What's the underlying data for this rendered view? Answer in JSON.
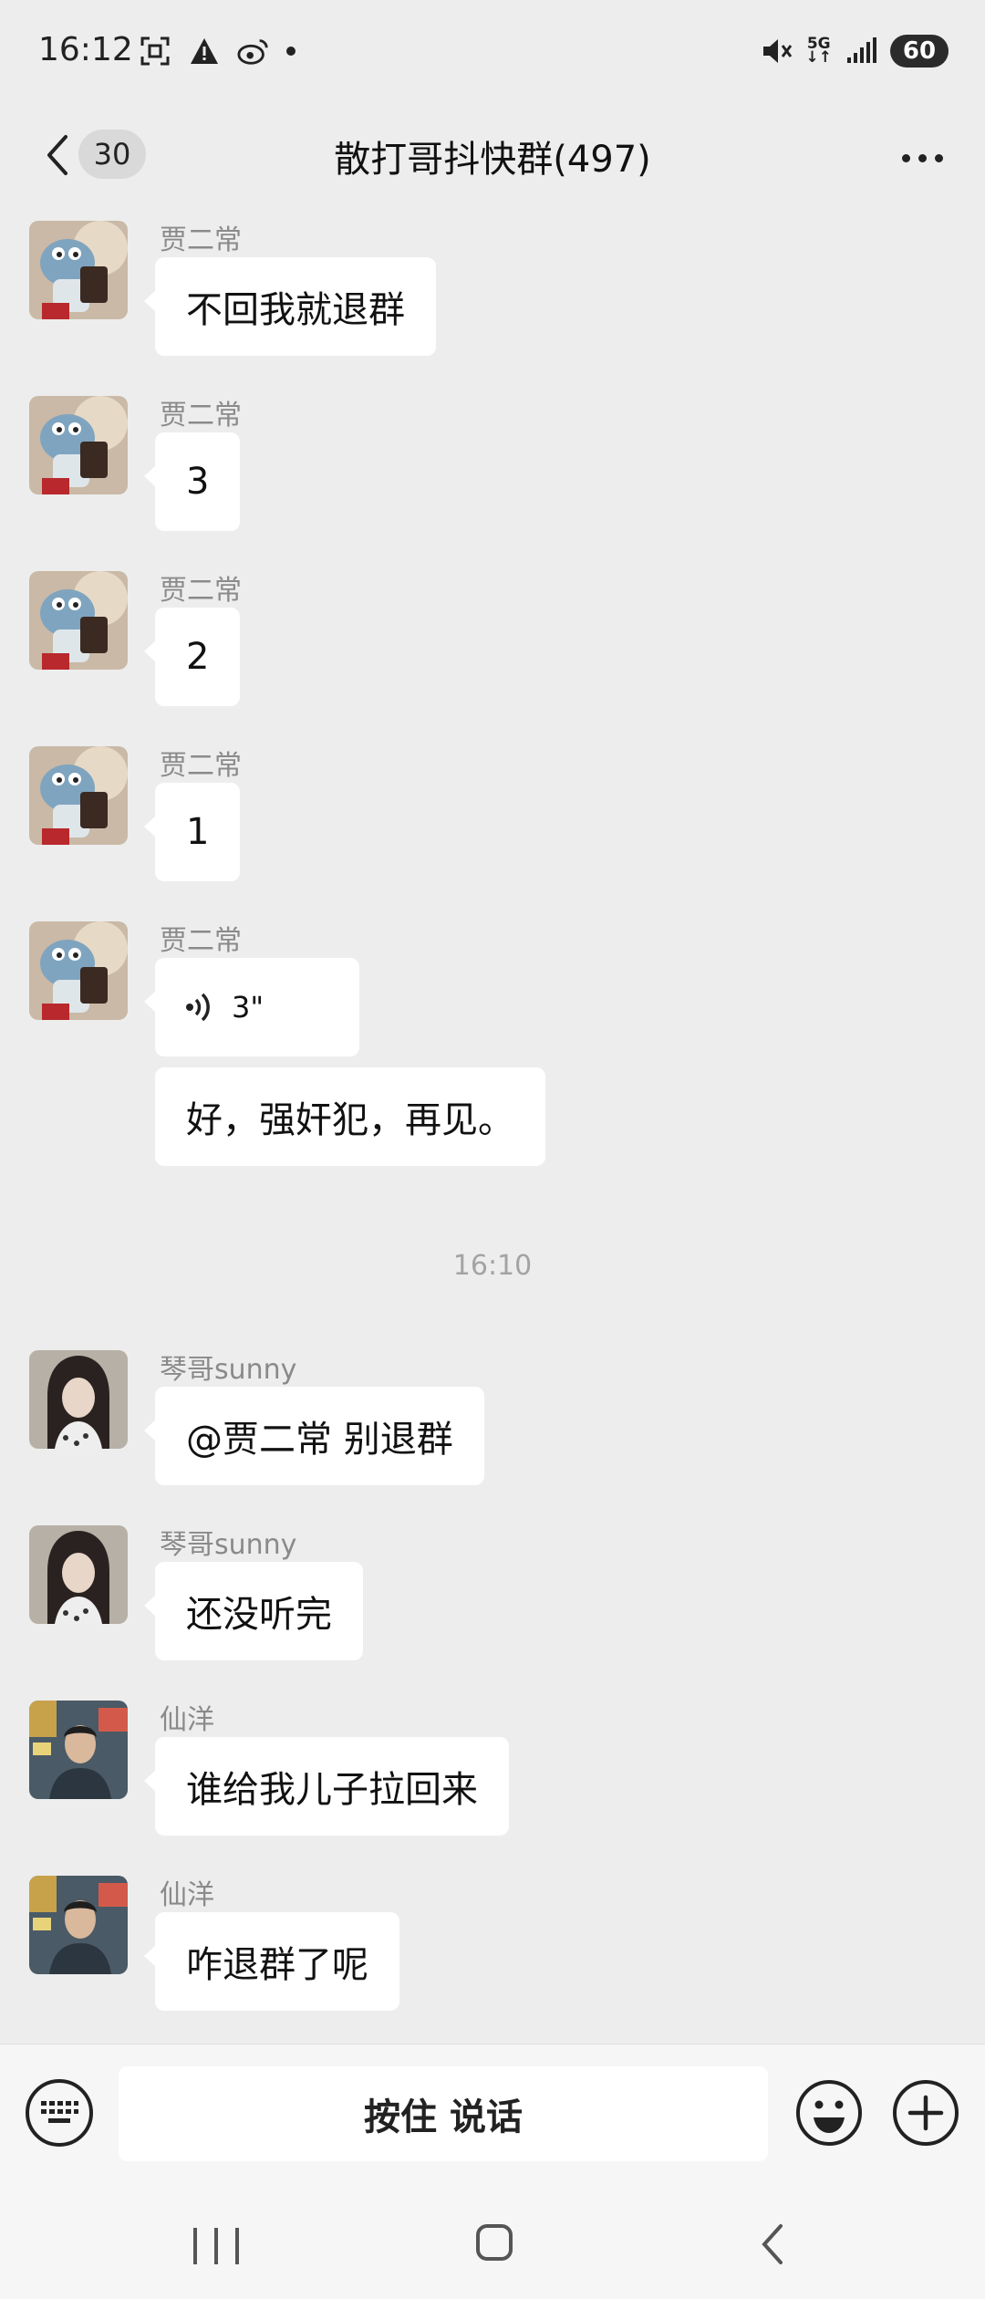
{
  "status_bar": {
    "time": "16:12",
    "icons_left": [
      "screenshot-icon",
      "warning-icon",
      "weibo-icon",
      "dot-icon"
    ],
    "icons_right": [
      "mute-icon",
      "5g-icon",
      "signal-icon"
    ],
    "network": "5G",
    "battery": "60"
  },
  "header": {
    "unread_count": "30",
    "title": "散打哥抖快群(497)"
  },
  "messages": [
    {
      "sender": "贾二常",
      "avatar": "plush-toy-avatar",
      "text": "不回我就退群"
    },
    {
      "sender": "贾二常",
      "avatar": "plush-toy-avatar",
      "text": "3"
    },
    {
      "sender": "贾二常",
      "avatar": "plush-toy-avatar",
      "text": "2"
    },
    {
      "sender": "贾二常",
      "avatar": "plush-toy-avatar",
      "text": "1"
    },
    {
      "sender": "贾二常",
      "avatar": "plush-toy-avatar",
      "voice_duration": "3\"",
      "text": "好，强奸犯，再见。"
    },
    {
      "sender": "琴哥sunny",
      "avatar": "woman-avatar",
      "text": "@贾二常  别退群"
    },
    {
      "sender": "琴哥sunny",
      "avatar": "woman-avatar",
      "text": "还没听完"
    },
    {
      "sender": "仙洋",
      "avatar": "man-street-avatar",
      "text": "谁给我儿子拉回来"
    },
    {
      "sender": "仙洋",
      "avatar": "man-street-avatar",
      "text": "咋退群了呢"
    }
  ],
  "timestamp": "16:10",
  "input_bar": {
    "hold_to_talk": "按住 说话"
  }
}
